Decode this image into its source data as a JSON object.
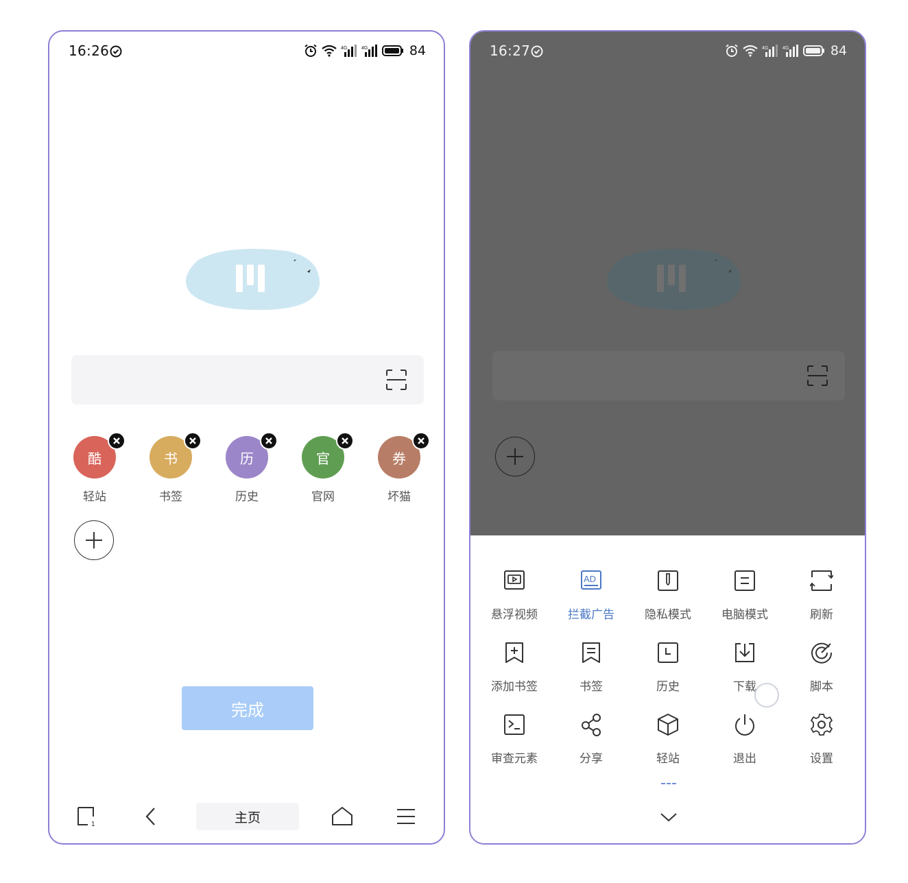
{
  "left_screen": {
    "status": {
      "time": "16:26",
      "battery": "84"
    },
    "shortcuts": [
      {
        "char": "酷",
        "label": "轻站",
        "color": "#d9645a"
      },
      {
        "char": "书",
        "label": "书签",
        "color": "#d8ac5e"
      },
      {
        "char": "历",
        "label": "历史",
        "color": "#9b86c9"
      },
      {
        "char": "官",
        "label": "官网",
        "color": "#5f9e52"
      },
      {
        "char": "券",
        "label": "坏猫",
        "color": "#b87d66"
      }
    ],
    "done_label": "完成",
    "nav": {
      "home_label": "主页"
    }
  },
  "right_screen": {
    "status": {
      "time": "16:27",
      "battery": "84"
    },
    "menu": [
      {
        "label": "悬浮视频",
        "icon": "floating-video-icon"
      },
      {
        "label": "拦截广告",
        "icon": "ad-block-icon",
        "active": true
      },
      {
        "label": "隐私模式",
        "icon": "privacy-mode-icon"
      },
      {
        "label": "电脑模式",
        "icon": "desktop-mode-icon"
      },
      {
        "label": "刷新",
        "icon": "refresh-icon"
      },
      {
        "label": "添加书签",
        "icon": "add-bookmark-icon"
      },
      {
        "label": "书签",
        "icon": "bookmarks-icon"
      },
      {
        "label": "历史",
        "icon": "history-icon"
      },
      {
        "label": "下载",
        "icon": "download-icon"
      },
      {
        "label": "脚本",
        "icon": "script-icon"
      },
      {
        "label": "审查元素",
        "icon": "inspect-element-icon"
      },
      {
        "label": "分享",
        "icon": "share-icon"
      },
      {
        "label": "轻站",
        "icon": "light-site-icon"
      },
      {
        "label": "退出",
        "icon": "power-icon"
      },
      {
        "label": "设置",
        "icon": "settings-icon"
      }
    ]
  }
}
